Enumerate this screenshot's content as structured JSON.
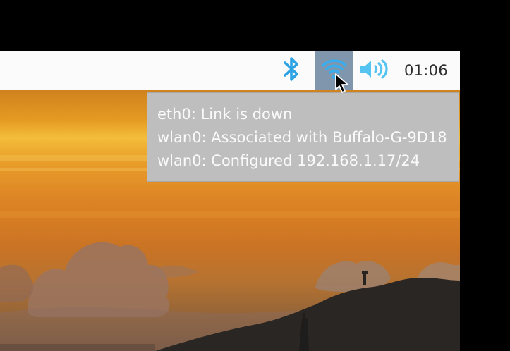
{
  "colors": {
    "tray_icon_blue": "#2ea3e4",
    "wifi_highlight": "#7f96ad",
    "panel_bg": "#fbfbfb",
    "tooltip_bg": "#bebebe",
    "tooltip_text": "#fafafa"
  },
  "panel": {
    "tray": {
      "bluetooth_icon": "bluetooth-icon",
      "wifi_icon": "wifi-icon",
      "volume_icon": "volume-icon",
      "clock": "01:06"
    }
  },
  "tooltip": {
    "lines": [
      "eth0: Link is down",
      "wlan0: Associated with Buffalo-G-9D18",
      "wlan0: Configured 192.168.1.17/24"
    ]
  },
  "cursor": {
    "icon": "mouse-pointer-icon"
  }
}
